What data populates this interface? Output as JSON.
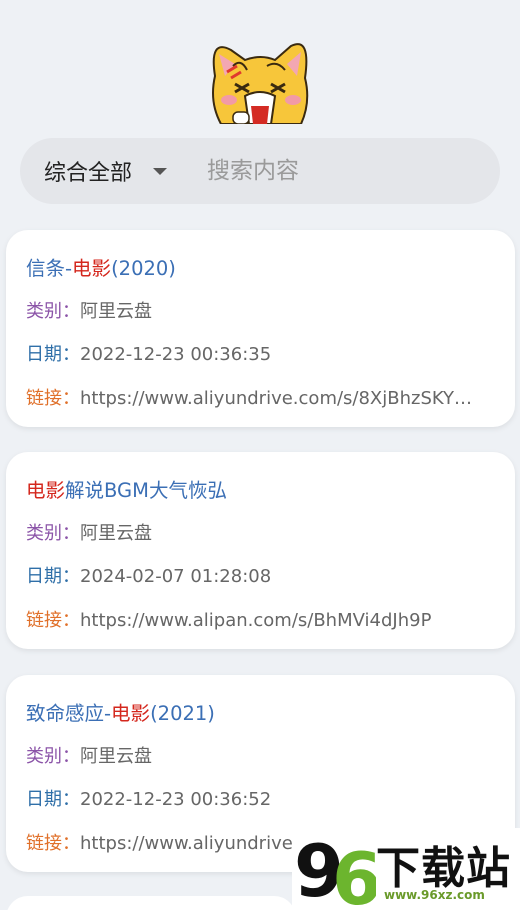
{
  "search": {
    "category": "综合全部",
    "placeholder": "搜索内容"
  },
  "labels": {
    "type": "类别：",
    "date": "日期：",
    "link": "链接："
  },
  "results": [
    {
      "title_parts": [
        "信条-",
        "电影",
        "(2020)"
      ],
      "type": "阿里云盘",
      "date": "2022-12-23 00:36:35",
      "link": "https://www.aliyundrive.com/s/8XjBhzSKY…"
    },
    {
      "title_parts": [
        "",
        "电影",
        "解说BGM大气恢弘"
      ],
      "type": "阿里云盘",
      "date": "2024-02-07 01:28:08",
      "link": "https://www.alipan.com/s/BhMVi4dJh9P"
    },
    {
      "title_parts": [
        "致命感应-",
        "电影",
        "(2021)"
      ],
      "type": "阿里云盘",
      "date": "2022-12-23 00:36:52",
      "link": "https://www.aliyundrive"
    }
  ],
  "watermark": {
    "digits": "96",
    "text": "下载站",
    "url": "www.96xz.com"
  },
  "colors": {
    "title": "#3b6fb5",
    "highlight": "#d4271d",
    "type_label": "#8b54a8",
    "date_label": "#2f6fa8",
    "link_label": "#e0702a"
  }
}
